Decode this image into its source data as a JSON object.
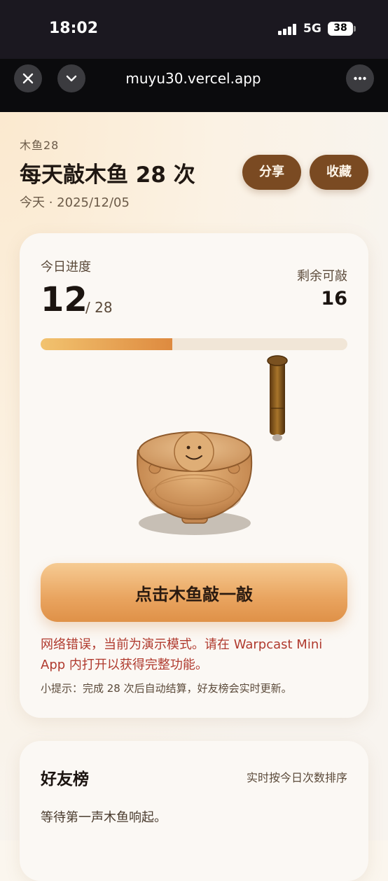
{
  "status_bar": {
    "time": "18:02",
    "network": "5G",
    "battery": "38"
  },
  "browser": {
    "url": "muyu30.vercel.app",
    "close_icon": "close-icon",
    "collapse_icon": "chevron-down-icon",
    "more_icon": "more-dots-icon"
  },
  "header": {
    "eyebrow": "木鱼28",
    "title": "每天敲木鱼 28 次",
    "date": "今天 · 2025/12/05",
    "share_label": "分享",
    "favorite_label": "收藏"
  },
  "progress": {
    "label": "今日进度",
    "count": "12",
    "total": "/ 28",
    "remaining_label": "剩余可敲",
    "remaining": "16",
    "fraction": 0.43,
    "colors": {
      "start": "#f2c36f",
      "end": "#de8a3f",
      "track": "#f1e6d7"
    }
  },
  "tap_button": {
    "label": "点击木鱼敲一敲"
  },
  "error_message": "网络错误，当前为演示模式。请在 Warpcast Mini App 内打开以获得完整功能。",
  "tip": "小提示：完成 28 次后自动结算，好友榜会实时更新。",
  "leaderboard": {
    "title": "好友榜",
    "subtitle": "实时按今日次数排序",
    "empty_text": "等待第一声木鱼响起。"
  },
  "colors": {
    "brand_brown": "#7a4a22",
    "error_red": "#b03a2e",
    "accent_orange": "#e9a45f"
  }
}
